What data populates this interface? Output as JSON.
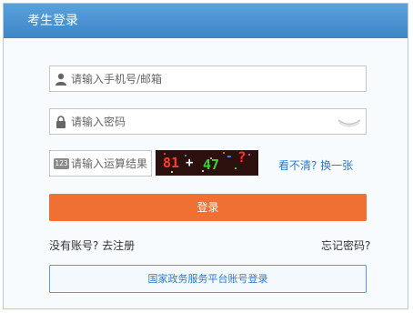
{
  "header": {
    "title": "考生登录"
  },
  "form": {
    "username_placeholder": "请输入手机号/邮箱",
    "password_placeholder": "请输入密码",
    "captcha_placeholder": "请输入运算结果",
    "captcha_badge": "123",
    "captcha_image": {
      "a": "81",
      "op": "+",
      "b": "47",
      "c": "-",
      "q": "?"
    },
    "refresh_captcha": "看不清? 换一张",
    "login_button": "登录"
  },
  "links": {
    "register": "没有账号? 去注册",
    "forgot": "忘记密码?",
    "gov_login": "国家政务服务平台账号登录"
  },
  "colors": {
    "header": "#4a95d4",
    "login_button": "#f06f32",
    "link": "#2f79c9",
    "captcha_bg": "#2b100d"
  }
}
